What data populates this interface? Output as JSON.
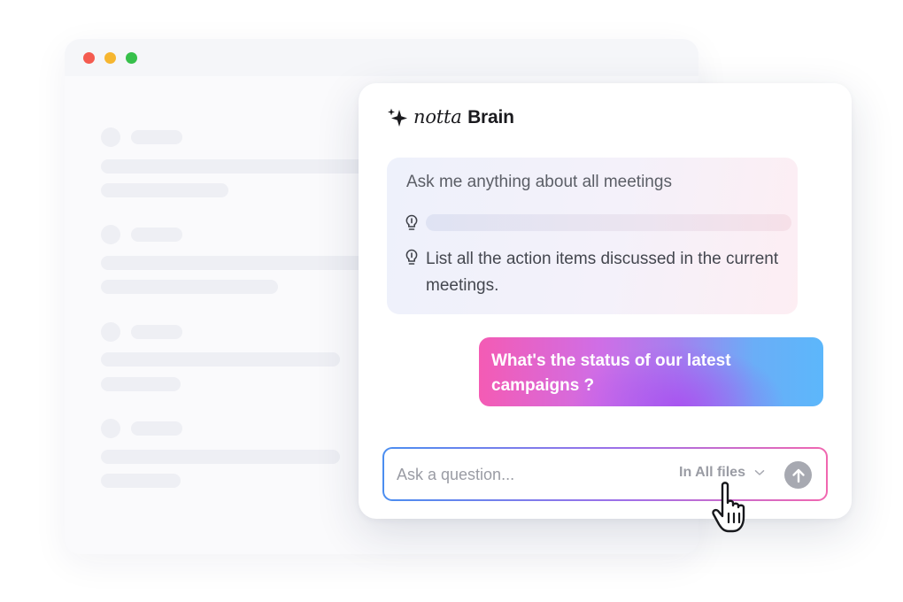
{
  "window_controls": {
    "close_color": "#f45b50",
    "minimize_color": "#f6b630",
    "maximize_color": "#37c04b"
  },
  "brand": {
    "icon": "sparkle-icon",
    "name_part1": "notta",
    "name_part2": "Brain"
  },
  "suggestions": {
    "title": "Ask me anything about all meetings",
    "items": [
      {
        "icon": "lightbulb-icon",
        "text": ""
      },
      {
        "icon": "lightbulb-icon",
        "text": "List all the action items discussed in the current meetings."
      }
    ]
  },
  "user_message": {
    "text": "What's the status of our latest campaigns ?"
  },
  "composer": {
    "placeholder": "Ask a question...",
    "scope_label": "In All files",
    "scope_icon": "chevron-down-icon",
    "send_icon": "arrow-up-icon"
  },
  "colors": {
    "accent_blue": "#4b8ef0",
    "accent_purple": "#a06fe8",
    "accent_pink": "#f167b0"
  }
}
